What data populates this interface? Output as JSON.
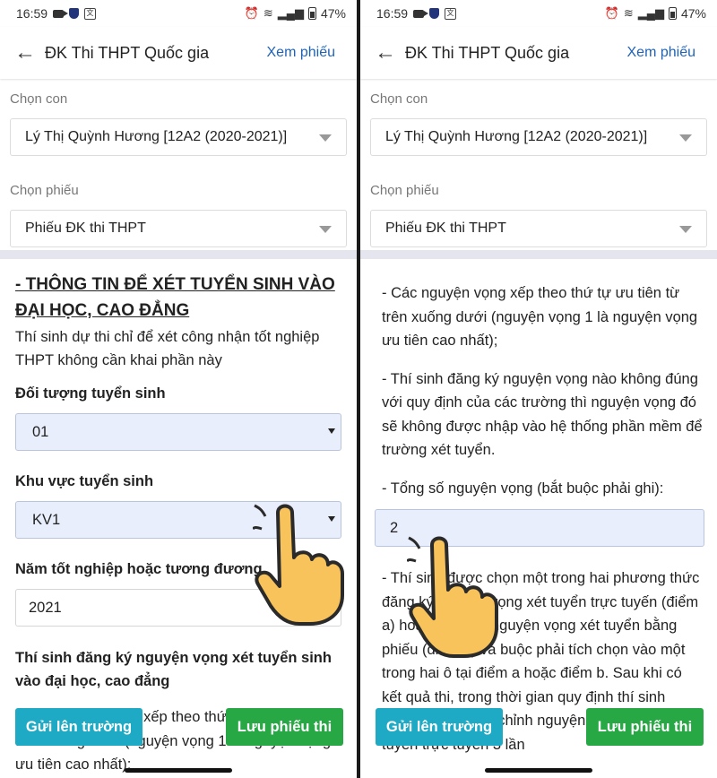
{
  "status_bar": {
    "time": "16:59",
    "battery": "47%"
  },
  "app_bar": {
    "title": "ĐK Thi THPT Quốc gia",
    "action": "Xem phiếu"
  },
  "selectors": {
    "child_label": "Chọn con",
    "child_value": "Lý Thị Quỳnh Hương [12A2 (2020-2021)]",
    "form_label": "Chọn phiếu",
    "form_value": "Phiếu ĐK thi THPT"
  },
  "left": {
    "section_title_line1": "- THÔNG TIN ĐỂ XÉT TUYỂN SINH VÀO",
    "section_title_line2": "ĐẠI HỌC, CAO ĐẲNG",
    "note": "Thí sinh dự thi chỉ để xét công nhận tốt nghiệp THPT không cần khai phần này",
    "target_label": "Đối tượng tuyển sinh",
    "target_value": "01",
    "region_label": "Khu vực tuyển sinh",
    "region_value": "KV1",
    "year_label": "Năm tốt nghiệp hoặc tương đương",
    "year_value": "2021",
    "wish_label": "Thí sinh đăng ký nguyện vọng xét tuyển sinh vào đại học, cao đẳng",
    "wish_text": "- Các nguyện vọng xếp theo thứ tự ưu tiên từ trên xuống dưới (nguyện vọng 1 là nguyện vọng ưu tiên cao nhất);"
  },
  "right": {
    "para1": "- Các nguyện vọng xếp theo thứ tự ưu tiên từ trên xuống dưới (nguyện vọng 1 là nguyện vọng ưu tiên cao nhất);",
    "para2": "- Thí sinh đăng ký nguyện vọng nào không đúng với quy định của các trường thì nguyện vọng đó sẽ không được nhập vào hệ thống phần mềm để trường xét tuyển.",
    "para3": "- Tổng số nguyện vọng (bắt buộc phải ghi):",
    "total_value": "2",
    "para4": "- Thí sinh được chọn một trong hai phương thức đăng ký nguyện vọng xét tuyển trực tuyến (điểm a) hoặc đăng ký nguyện vọng xét tuyển bằng phiếu (điểm b) và buộc phải tích chọn vào một trong hai ô tại điểm a hoặc điểm b. Sau khi có kết quả thi, trong thời gian quy định thí sinh được quyền điều chỉnh nguyện vọng đăng ký xét tuyển trực tuyến 3 lần"
  },
  "buttons": {
    "send": "Gửi lên trường",
    "save": "Lưu phiếu thi"
  },
  "colors": {
    "accent_blue": "#1e63b8",
    "send_button": "#1eaac4",
    "save_button": "#27a844",
    "input_fill": "#e8eefc"
  }
}
